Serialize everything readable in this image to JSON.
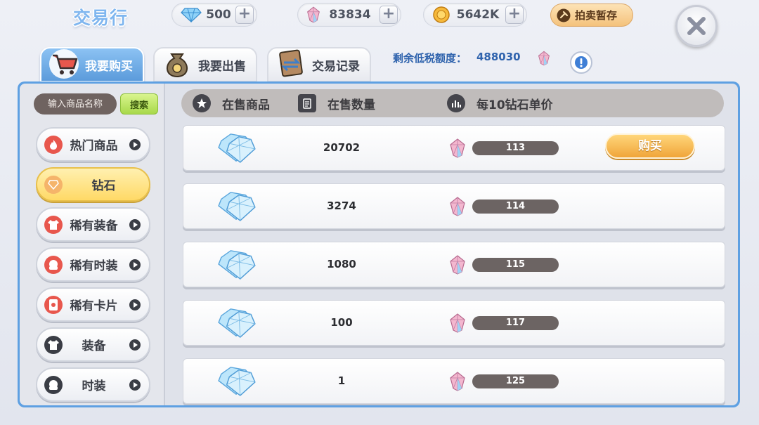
{
  "header": {
    "title": "交易行",
    "diamonds": "500",
    "crystals": "83834",
    "gold": "5642K",
    "auction_label": "拍卖暂存"
  },
  "tabs": [
    {
      "label": "我要购买",
      "active": true
    },
    {
      "label": "我要出售",
      "active": false
    },
    {
      "label": "交易记录",
      "active": false
    }
  ],
  "tax": {
    "label": "剩余低税额度：",
    "value": "488030"
  },
  "search": {
    "placeholder": "输入商品名称",
    "button_label": "搜索"
  },
  "categories": [
    {
      "label": "热门商品",
      "icon": "hot-icon"
    },
    {
      "label": "钻石",
      "icon": "diamond-icon",
      "active": true
    },
    {
      "label": "稀有装备",
      "icon": "shirt-icon"
    },
    {
      "label": "稀有时装",
      "icon": "costume-icon"
    },
    {
      "label": "稀有卡片",
      "icon": "card-icon"
    },
    {
      "label": "装备",
      "icon": "shirt-icon"
    },
    {
      "label": "时装",
      "icon": "costume-icon"
    }
  ],
  "table": {
    "col_item": "在售商品",
    "col_qty": "在售数量",
    "col_price": "每10钻石单价",
    "buy_label": "购买",
    "rows": [
      {
        "qty": "20702",
        "price": "113"
      },
      {
        "qty": "3274",
        "price": "114"
      },
      {
        "qty": "1080",
        "price": "115"
      },
      {
        "qty": "100",
        "price": "117"
      },
      {
        "qty": "1",
        "price": "125"
      }
    ]
  },
  "colors": {
    "accent_blue": "#5ea0e2",
    "buy_orange": "#f0a53a",
    "active_category": "#ffd966"
  }
}
